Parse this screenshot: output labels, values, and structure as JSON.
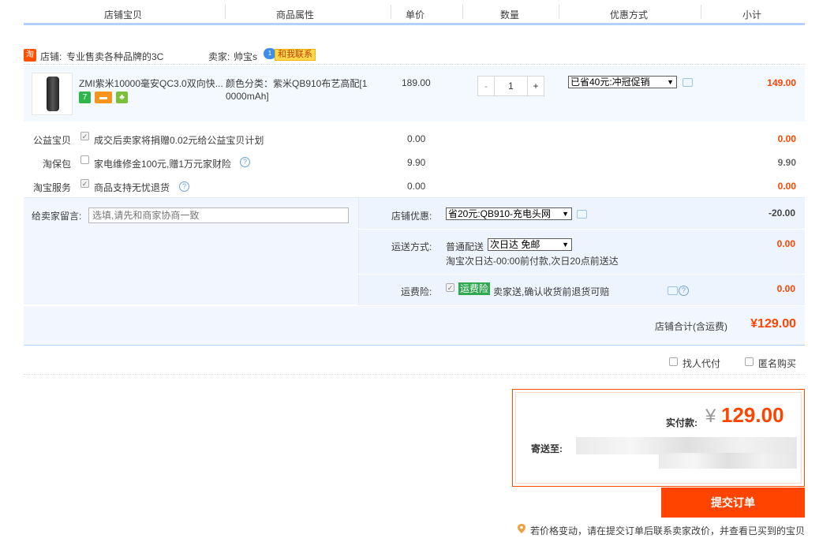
{
  "header": {
    "col_item": "店铺宝贝",
    "col_attr": "商品属性",
    "col_price": "单价",
    "col_qty": "数量",
    "col_discount": "优惠方式",
    "col_subtotal": "小计"
  },
  "shop": {
    "icon": "淘",
    "label": "店铺:",
    "name": "专业售卖各种品牌的3C",
    "seller_label": "卖家:",
    "seller_name": "帅宝s",
    "contact": "和我联系"
  },
  "item": {
    "title": "ZMI紫米10000毫安QC3.0双向快...",
    "attr_line1": "颜色分类：紫米QB910布艺高配[1",
    "attr_line2": "0000mAh]",
    "price": "189.00",
    "qty": "1",
    "discount": "已省40元:冲冠促销",
    "subtotal": "149.00"
  },
  "services": [
    {
      "label": "公益宝贝",
      "text": "成交后卖家将捐赠0.02元给公益宝贝计划",
      "price": "0.00",
      "subtotal": "0.00",
      "checked": true
    },
    {
      "label": "淘保包",
      "text": "家电维修金100元,赠1万元家财险",
      "price": "9.90",
      "subtotal": "9.90",
      "checked": false
    },
    {
      "label": "淘宝服务",
      "text": "商品支持无忧退货",
      "price": "0.00",
      "subtotal": "0.00",
      "checked": true
    }
  ],
  "note": {
    "label": "给卖家留言:",
    "placeholder": "选填,请先和商家协商一致"
  },
  "shop_discount": {
    "label": "店铺优惠:",
    "value": "省20元:QB910-充电头网",
    "amount": "-20.00"
  },
  "shipping": {
    "label": "运送方式:",
    "method": "普通配送",
    "option": "次日达 免邮",
    "desc": "淘宝次日达-00:00前付款,次日20点前送达",
    "amount": "0.00"
  },
  "insurance": {
    "label": "运费险:",
    "tag": "运费险",
    "text": "卖家送,确认收货前退货可赔",
    "amount": "0.00"
  },
  "shop_total": {
    "label": "店铺合计(含运费)",
    "amount": "¥129.00"
  },
  "options": {
    "proxy_pay": "找人代付",
    "anonymous": "匿名购买"
  },
  "payment": {
    "label": "实付款:",
    "currency": "¥",
    "amount": "129.00",
    "ship_to_label": "寄送至:"
  },
  "submit_label": "提交订单",
  "footer_tip": "若价格变动，请在提交订单后联系卖家改价，并查看已买到的宝贝",
  "colors": {
    "accent": "#ff4400",
    "header_line": "#b2d1ff",
    "panel_bg": "#f2f7ff"
  }
}
